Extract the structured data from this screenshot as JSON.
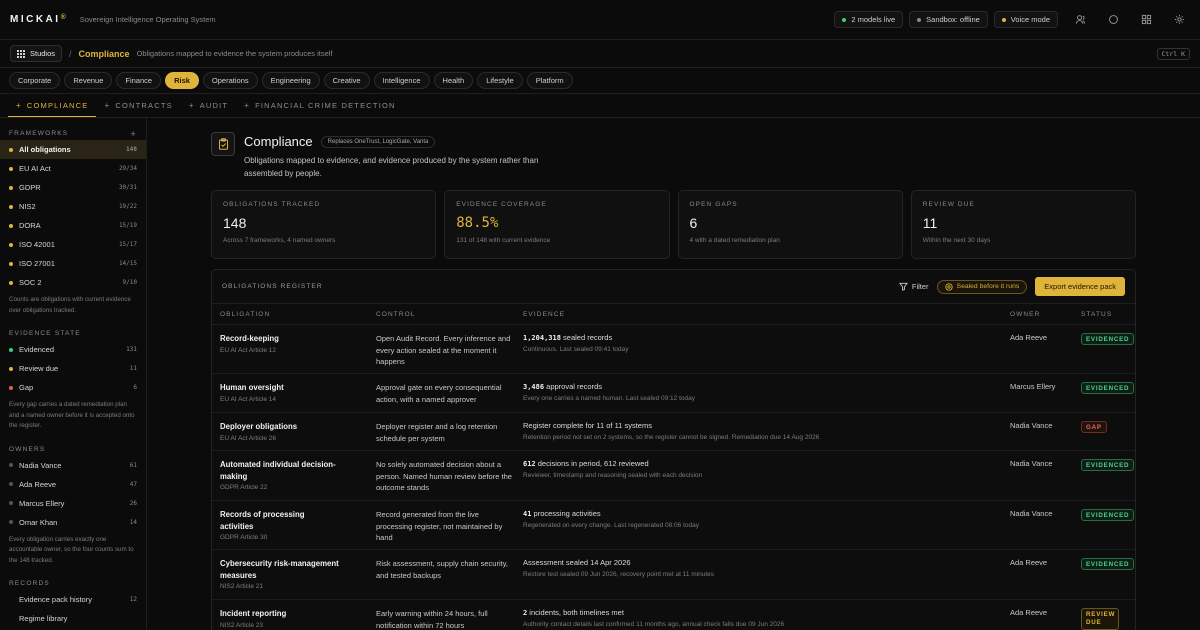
{
  "app": {
    "logo": "MICKAI",
    "logo_mark": "®",
    "tagline": "Sovereign Intelligence Operating System",
    "status": [
      {
        "label": "2 models live",
        "color": "#3fcf7a"
      },
      {
        "label": "Sandbox: offline",
        "color": "#8a8a8a"
      },
      {
        "label": "Voice mode",
        "color": "#e0b43a"
      }
    ]
  },
  "breadcrumb": {
    "studios": "Studios",
    "separator": "/",
    "title": "Compliance",
    "subtitle": "Obligations mapped to evidence the system produces itself",
    "shortcut": "Ctrl K"
  },
  "categories": [
    "Corporate",
    "Revenue",
    "Finance",
    "Risk",
    "Operations",
    "Engineering",
    "Creative",
    "Intelligence",
    "Health",
    "Lifestyle",
    "Platform"
  ],
  "active_category": "Risk",
  "subtabs": [
    "COMPLIANCE",
    "CONTRACTS",
    "AUDIT",
    "FINANCIAL CRIME DETECTION"
  ],
  "sidebar": {
    "frameworks_title": "FRAMEWORKS",
    "frameworks": [
      {
        "label": "All obligations",
        "count": "148",
        "active": true
      },
      {
        "label": "EU AI Act",
        "count": "29/34"
      },
      {
        "label": "GDPR",
        "count": "30/31"
      },
      {
        "label": "NIS2",
        "count": "19/22"
      },
      {
        "label": "DORA",
        "count": "15/19"
      },
      {
        "label": "ISO 42001",
        "count": "15/17"
      },
      {
        "label": "ISO 27001",
        "count": "14/15"
      },
      {
        "label": "SOC 2",
        "count": "9/10"
      }
    ],
    "frameworks_note": "Counts are obligations with current evidence over obligations tracked.",
    "evidence_title": "EVIDENCE STATE",
    "evidence": [
      {
        "label": "Evidenced",
        "count": "131",
        "color": "#3fcf7a"
      },
      {
        "label": "Review due",
        "count": "11",
        "color": "#e0b43a"
      },
      {
        "label": "Gap",
        "count": "6",
        "color": "#e0604a"
      }
    ],
    "evidence_note": "Every gap carries a dated remediation plan and a named owner before it is accepted onto the register.",
    "owners_title": "OWNERS",
    "owners": [
      {
        "label": "Nadia Vance",
        "count": "61"
      },
      {
        "label": "Ada Reeve",
        "count": "47"
      },
      {
        "label": "Marcus Ellery",
        "count": "26"
      },
      {
        "label": "Omar Khan",
        "count": "14"
      }
    ],
    "owners_note": "Every obligation carries exactly one accountable owner, so the four counts sum to the 148 tracked.",
    "records_title": "RECORDS",
    "records": [
      {
        "label": "Evidence pack history",
        "count": "12"
      },
      {
        "label": "Regime library",
        "count": ""
      }
    ]
  },
  "header": {
    "title": "Compliance",
    "replaces": "Replaces OneTrust, LogicGate, Vanta",
    "description": "Obligations mapped to evidence, and evidence produced by the system rather than assembled by people."
  },
  "stats": [
    {
      "label": "OBLIGATIONS TRACKED",
      "value": "148",
      "sub": "Across 7 frameworks, 4 named owners",
      "accent": false
    },
    {
      "label": "EVIDENCE COVERAGE",
      "value": "88.5%",
      "sub": "131 of 148 with current evidence",
      "accent": true
    },
    {
      "label": "OPEN GAPS",
      "value": "6",
      "sub": "4 with a dated remediation plan",
      "accent": false
    },
    {
      "label": "REVIEW DUE",
      "value": "11",
      "sub": "Within the next 30 days",
      "accent": false
    }
  ],
  "register": {
    "title": "OBLIGATIONS REGISTER",
    "filter": "Filter",
    "sealed": "Sealed before it runs",
    "export": "Export evidence pack",
    "columns": [
      "OBLIGATION",
      "CONTROL",
      "EVIDENCE",
      "OWNER",
      "STATUS"
    ],
    "rows": [
      {
        "name": "Record-keeping",
        "ref": "EU AI Act Article 12",
        "control": "Open Audit Record. Every inference and every action sealed at the moment it happens",
        "ev_num": "1,204,318",
        "ev_text": " sealed records",
        "ev_sub": "Continuous. Last sealed 09:41 today",
        "owner": "Ada Reeve",
        "status": "EVIDENCED",
        "kind": "ev",
        "h": 49
      },
      {
        "name": "Human oversight",
        "ref": "EU AI Act Article 14",
        "control": "Approval gate on every consequential action, with a named approver",
        "ev_num": "3,486",
        "ev_text": " approval records",
        "ev_sub": "Every one carries a named human. Last sealed 09:12 today",
        "owner": "Marcus Ellery",
        "status": "EVIDENCED",
        "kind": "ev",
        "h": 39
      },
      {
        "name": "Deployer obligations",
        "ref": "EU AI Act Article 26",
        "control": "Deployer register and a log retention schedule per system",
        "ev_num": "",
        "ev_text": "Register complete for 11 of 11 systems",
        "ev_sub": "Retention period not set on 2 systems, so the register cannot be signed. Remediation due 14 Aug 2026",
        "owner": "Nadia Vance",
        "status": "GAP",
        "kind": "gap",
        "h": 38
      },
      {
        "name": "Automated individual decision-making",
        "ref": "GDPR Article 22",
        "control": "No solely automated decision about a person. Named human review before the outcome stands",
        "ev_num": "612",
        "ev_text": " decisions in period, 612 reviewed",
        "ev_sub": "Reviewer, timestamp and reasoning sealed with each decision",
        "owner": "Nadia Vance",
        "status": "EVIDENCED",
        "kind": "ev",
        "h": 50
      },
      {
        "name": "Records of processing activities",
        "ref": "GDPR Article 30",
        "control": "Record generated from the live processing register, not maintained by hand",
        "ev_num": "41",
        "ev_text": " processing activities",
        "ev_sub": "Regenerated on every change. Last regenerated 08:06 today",
        "owner": "Nadia Vance",
        "status": "EVIDENCED",
        "kind": "ev",
        "h": 49
      },
      {
        "name": "Cybersecurity risk-management measures",
        "ref": "NIS2 Article 21",
        "control": "Risk assessment, supply chain security, and tested backups",
        "ev_num": "",
        "ev_text": "Assessment sealed 14 Apr 2026",
        "ev_sub": "Restore test sealed 09 Jun 2026, recovery point met at 11 minutes",
        "owner": "Ada Reeve",
        "status": "EVIDENCED",
        "kind": "ev",
        "h": 50
      },
      {
        "name": "Incident reporting",
        "ref": "NIS2 Article 23",
        "control": "Early warning within 24 hours, full notification within 72 hours",
        "ev_num": "2",
        "ev_text": " incidents, both timelines met",
        "ev_sub": "Authority contact details last confirmed 11 months ago, annual check falls due 09 Jun 2026",
        "owner": "Ada Reeve",
        "status": "REVIEW DUE",
        "kind": "rd",
        "h": 40
      }
    ]
  }
}
